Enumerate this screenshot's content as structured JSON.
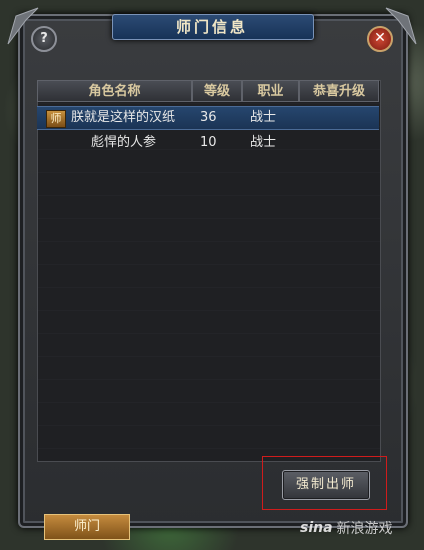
{
  "window": {
    "title": "师门信息"
  },
  "buttons": {
    "help": "?",
    "close": "✕",
    "force_leave": "强制出师"
  },
  "table": {
    "headers": [
      "角色名称",
      "等级",
      "职业",
      "恭喜升级"
    ],
    "rows": [
      {
        "badge": "师",
        "name": "朕就是这样的汉纸",
        "level": "36",
        "class": "战士",
        "congrats": ""
      },
      {
        "badge": "",
        "name": "彪悍的人参",
        "level": "10",
        "class": "战士",
        "congrats": ""
      }
    ]
  },
  "tabs": {
    "master": "师门"
  },
  "watermark": {
    "logo": "sina",
    "text": "新浪游戏"
  },
  "colors": {
    "selected_row": "#26466e",
    "highlight_box": "#d01c1c",
    "tab": "#c58b3e"
  }
}
